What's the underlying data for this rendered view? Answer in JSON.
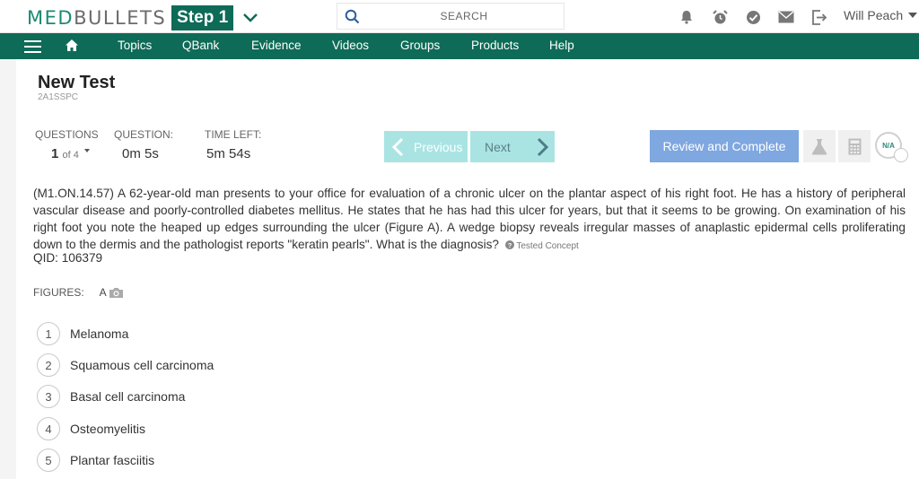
{
  "logo": {
    "brand_part1": "MED",
    "brand_part2": "BULLETS",
    "step": "Step 1"
  },
  "search": {
    "placeholder": "SEARCH"
  },
  "user": {
    "name": "Will Peach"
  },
  "nav": {
    "items": [
      "Topics",
      "QBank",
      "Evidence",
      "Videos",
      "Groups",
      "Products",
      "Help"
    ]
  },
  "test": {
    "title": "New Test",
    "code": "2A1SSPC"
  },
  "stats": {
    "questions_label": "QUESTIONS",
    "question_current": "1",
    "question_total_text": "of 4",
    "question_time_label": "QUESTION:",
    "question_time": "0m 5s",
    "time_left_label": "TIME LEFT:",
    "time_left": "5m 54s"
  },
  "buttons": {
    "previous": "Previous",
    "next": "Next",
    "review": "Review and Complete",
    "na": "N/A"
  },
  "question": {
    "text": "(M1.ON.14.57) A 62-year-old man presents to your office for evaluation of a chronic ulcer on the plantar aspect of his right foot. He has a history of peripheral vascular disease and poorly-controlled diabetes mellitus. He states that he has had this ulcer for years, but that it seems to be growing. On examination of his right foot you note the heaped up edges surrounding the ulcer (Figure A). A wedge biopsy reveals irregular masses of anaplastic epidermal cells proliferating down to the dermis and the pathologist reports \"keratin pearls\". What is the diagnosis?",
    "tested_concept": "Tested Concept",
    "qid": "QID: 106379"
  },
  "figures": {
    "label": "FIGURES:",
    "items": [
      "A"
    ]
  },
  "answers": [
    {
      "num": "1",
      "text": "Melanoma"
    },
    {
      "num": "2",
      "text": "Squamous cell carcinoma"
    },
    {
      "num": "3",
      "text": "Basal cell carcinoma"
    },
    {
      "num": "4",
      "text": "Osteomyelitis"
    },
    {
      "num": "5",
      "text": "Plantar fasciitis"
    }
  ],
  "colors": {
    "brand_green": "#0e6b57",
    "nav_button": "#a9e4e3",
    "review_button": "#7fa7e0"
  }
}
